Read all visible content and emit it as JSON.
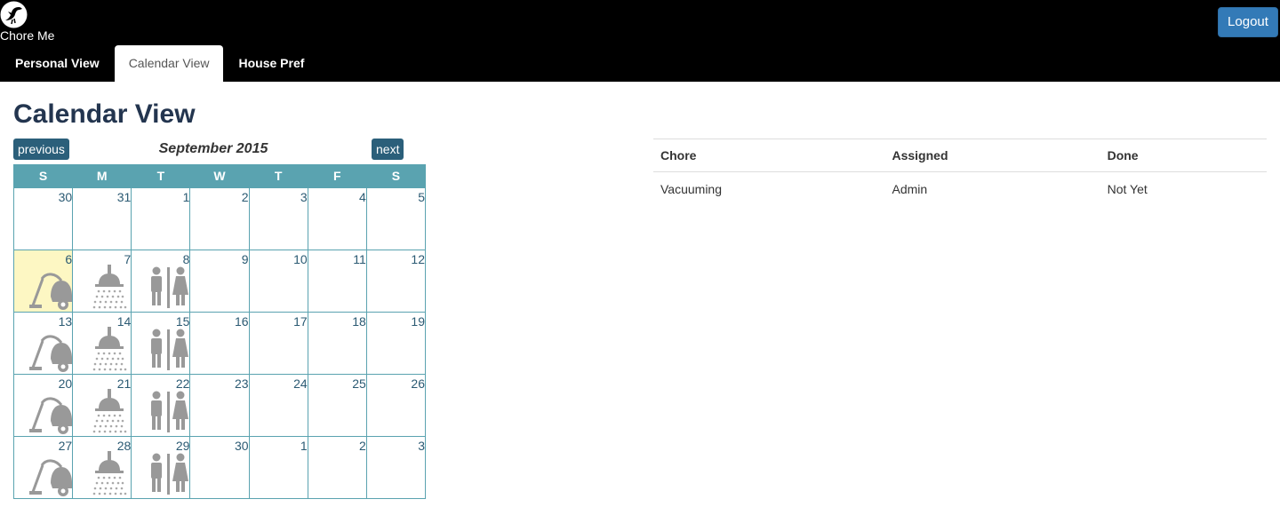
{
  "brand": {
    "name": "Chore Me",
    "logo_icon": "bird-logo-icon"
  },
  "header": {
    "logout_label": "Logout"
  },
  "tabs": [
    {
      "label": "Personal View",
      "active": false
    },
    {
      "label": "Calendar View",
      "active": true
    },
    {
      "label": "House Pref",
      "active": false
    }
  ],
  "page": {
    "title": "Calendar View"
  },
  "calendar": {
    "prev_label": "previous",
    "next_label": "next",
    "month_label": "September 2015",
    "weekdays": [
      "S",
      "M",
      "T",
      "W",
      "T",
      "F",
      "S"
    ],
    "highlight_color": "#fdf7c3",
    "header_color": "#5aa3b0",
    "weeks": [
      [
        {
          "day": "30"
        },
        {
          "day": "31"
        },
        {
          "day": "1"
        },
        {
          "day": "2"
        },
        {
          "day": "3"
        },
        {
          "day": "4"
        },
        {
          "day": "5"
        }
      ],
      [
        {
          "day": "6",
          "icon": "vacuum-icon",
          "today": true
        },
        {
          "day": "7",
          "icon": "shower-icon"
        },
        {
          "day": "8",
          "icon": "restroom-icon"
        },
        {
          "day": "9"
        },
        {
          "day": "10"
        },
        {
          "day": "11"
        },
        {
          "day": "12"
        }
      ],
      [
        {
          "day": "13",
          "icon": "vacuum-icon"
        },
        {
          "day": "14",
          "icon": "shower-icon"
        },
        {
          "day": "15",
          "icon": "restroom-icon"
        },
        {
          "day": "16"
        },
        {
          "day": "17"
        },
        {
          "day": "18"
        },
        {
          "day": "19"
        }
      ],
      [
        {
          "day": "20",
          "icon": "vacuum-icon"
        },
        {
          "day": "21",
          "icon": "shower-icon"
        },
        {
          "day": "22",
          "icon": "restroom-icon"
        },
        {
          "day": "23"
        },
        {
          "day": "24"
        },
        {
          "day": "25"
        },
        {
          "day": "26"
        }
      ],
      [
        {
          "day": "27",
          "icon": "vacuum-icon"
        },
        {
          "day": "28",
          "icon": "shower-icon"
        },
        {
          "day": "29",
          "icon": "restroom-icon"
        },
        {
          "day": "30"
        },
        {
          "day": "1"
        },
        {
          "day": "2"
        },
        {
          "day": "3"
        }
      ]
    ]
  },
  "chore_table": {
    "headers": [
      "Chore",
      "Assigned",
      "Done"
    ],
    "rows": [
      [
        "Vacuuming",
        "Admin",
        "Not Yet"
      ]
    ]
  }
}
